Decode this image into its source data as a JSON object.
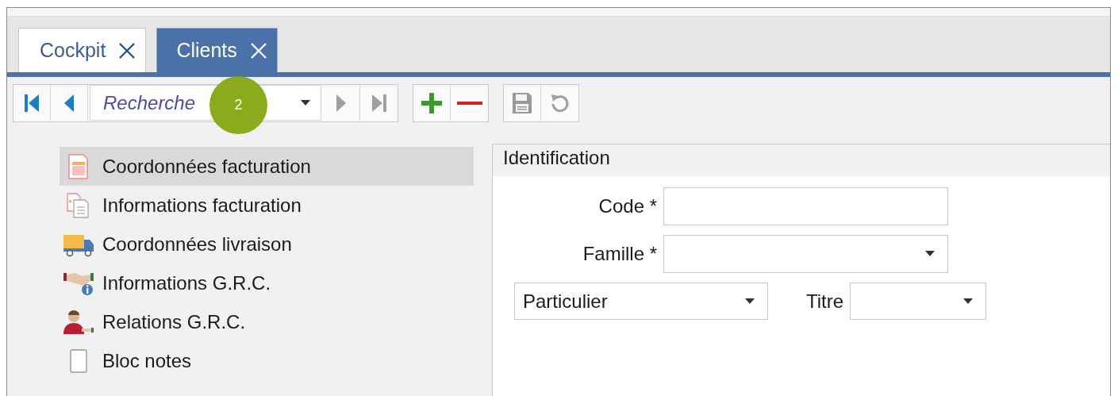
{
  "tabs": [
    {
      "label": "Cockpit",
      "selected": false
    },
    {
      "label": "Clients",
      "selected": true
    }
  ],
  "toolbar": {
    "nav_buttons": [
      {
        "kind": "first",
        "disabled": false
      },
      {
        "kind": "previous",
        "disabled": false
      }
    ],
    "search": {
      "placeholder": "Recherche"
    },
    "nav_buttons_after": [
      {
        "kind": "next",
        "disabled": true
      },
      {
        "kind": "last",
        "disabled": true
      }
    ],
    "edit_buttons": [
      {
        "kind": "add",
        "disabled": false
      },
      {
        "kind": "remove",
        "disabled": false
      }
    ],
    "save_buttons": [
      {
        "kind": "save",
        "disabled": true
      },
      {
        "kind": "reset",
        "disabled": true
      }
    ]
  },
  "callout": {
    "label": "2"
  },
  "sidebar": {
    "items": [
      {
        "label": "Coordonnées facturation",
        "selected": true
      },
      {
        "label": "Informations facturation",
        "selected": false
      },
      {
        "label": "Coordonnées livraison",
        "selected": false
      },
      {
        "label": "Informations G.R.C.",
        "selected": false
      },
      {
        "label": "Relations G.R.C.",
        "selected": false
      },
      {
        "label": "Bloc notes",
        "selected": false
      }
    ]
  },
  "panel": {
    "title": "Identification",
    "fields": [
      {
        "label": "Code *",
        "kind": "text"
      },
      {
        "label": "Famille *",
        "kind": "dropdown"
      }
    ],
    "type_select": {
      "value": "Particulier"
    },
    "title_select": {
      "label": "Titre"
    }
  }
}
